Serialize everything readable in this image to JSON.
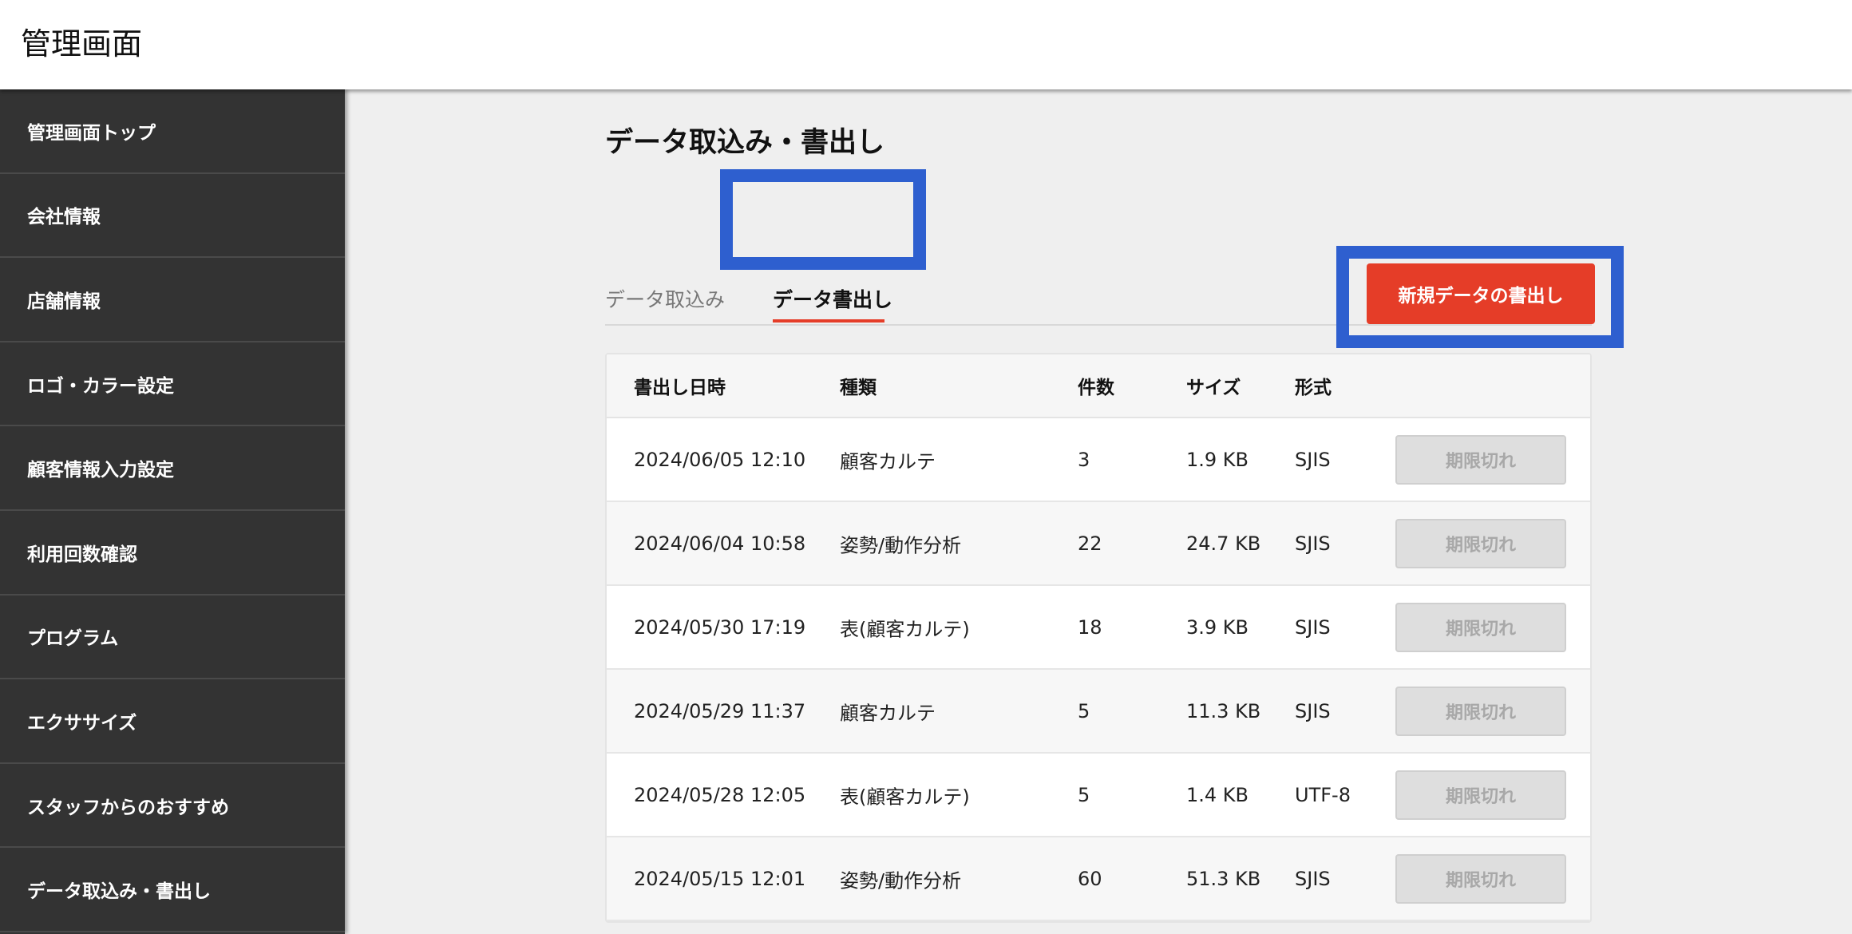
{
  "header": {
    "title": "管理画面"
  },
  "sidebar": {
    "items": [
      {
        "label": "管理画面トップ"
      },
      {
        "label": "会社情報"
      },
      {
        "label": "店舗情報"
      },
      {
        "label": "ロゴ・カラー設定"
      },
      {
        "label": "顧客情報入力設定"
      },
      {
        "label": "利用回数確認"
      },
      {
        "label": "プログラム"
      },
      {
        "label": "エクササイズ"
      },
      {
        "label": "スタッフからのおすすめ"
      },
      {
        "label": "データ取込み・書出し"
      }
    ]
  },
  "main": {
    "title": "データ取込み・書出し",
    "tabs": [
      {
        "label": "データ取込み",
        "active": false
      },
      {
        "label": "データ書出し",
        "active": true
      }
    ],
    "new_export_button": "新規データの書出し",
    "table": {
      "headers": [
        "書出し日時",
        "種類",
        "件数",
        "サイズ",
        "形式"
      ],
      "rows": [
        {
          "datetime": "2024/06/05 12:10",
          "type": "顧客カルテ",
          "count": "3",
          "size": "1.9 KB",
          "format": "SJIS",
          "action": "期限切れ"
        },
        {
          "datetime": "2024/06/04 10:58",
          "type": "姿勢/動作分析",
          "count": "22",
          "size": "24.7 KB",
          "format": "SJIS",
          "action": "期限切れ"
        },
        {
          "datetime": "2024/05/30 17:19",
          "type": "表(顧客カルテ)",
          "count": "18",
          "size": "3.9 KB",
          "format": "SJIS",
          "action": "期限切れ"
        },
        {
          "datetime": "2024/05/29 11:37",
          "type": "顧客カルテ",
          "count": "5",
          "size": "11.3 KB",
          "format": "SJIS",
          "action": "期限切れ"
        },
        {
          "datetime": "2024/05/28 12:05",
          "type": "表(顧客カルテ)",
          "count": "5",
          "size": "1.4 KB",
          "format": "UTF-8",
          "action": "期限切れ"
        },
        {
          "datetime": "2024/05/15 12:01",
          "type": "姿勢/動作分析",
          "count": "60",
          "size": "51.3 KB",
          "format": "SJIS",
          "action": "期限切れ"
        }
      ]
    }
  },
  "colors": {
    "accent": "#e53d28",
    "highlight": "#2e5fcf",
    "sidebar_bg": "#333333"
  }
}
